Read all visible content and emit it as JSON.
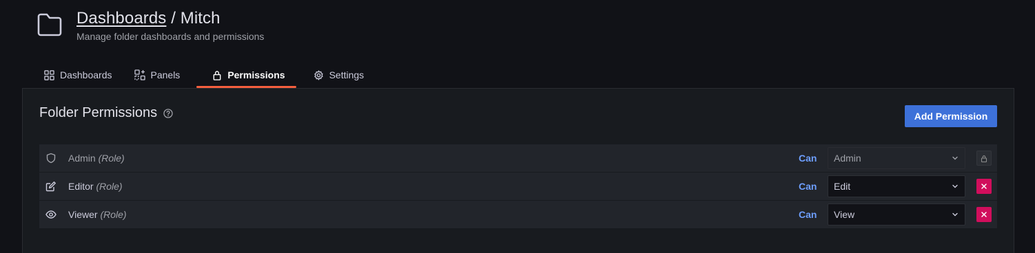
{
  "header": {
    "breadcrumb_link": "Dashboards",
    "separator": " / ",
    "folder_name": "Mitch",
    "subtitle": "Manage folder dashboards and permissions"
  },
  "tabs": [
    {
      "label": "Dashboards",
      "icon": "apps-icon"
    },
    {
      "label": "Panels",
      "icon": "library-panel-icon"
    },
    {
      "label": "Permissions",
      "icon": "lock-icon",
      "active": true
    },
    {
      "label": "Settings",
      "icon": "cog-icon"
    }
  ],
  "panel": {
    "title": "Folder Permissions",
    "add_button": "Add Permission"
  },
  "permissions": [
    {
      "name": "Admin",
      "role": "(Role)",
      "can": "Can",
      "level": "Admin",
      "icon": "shield-icon",
      "locked": true
    },
    {
      "name": "Editor",
      "role": "(Role)",
      "can": "Can",
      "level": "Edit",
      "icon": "edit-icon",
      "locked": false
    },
    {
      "name": "Viewer",
      "role": "(Role)",
      "can": "Can",
      "level": "View",
      "icon": "eye-icon",
      "locked": false
    }
  ],
  "colors": {
    "background": "#111217",
    "panel": "#181b1f",
    "accent_tab": "#f55f3e",
    "primary_button": "#3d71d9",
    "can_text": "#6e9fff",
    "delete_button": "#d10e5c"
  }
}
